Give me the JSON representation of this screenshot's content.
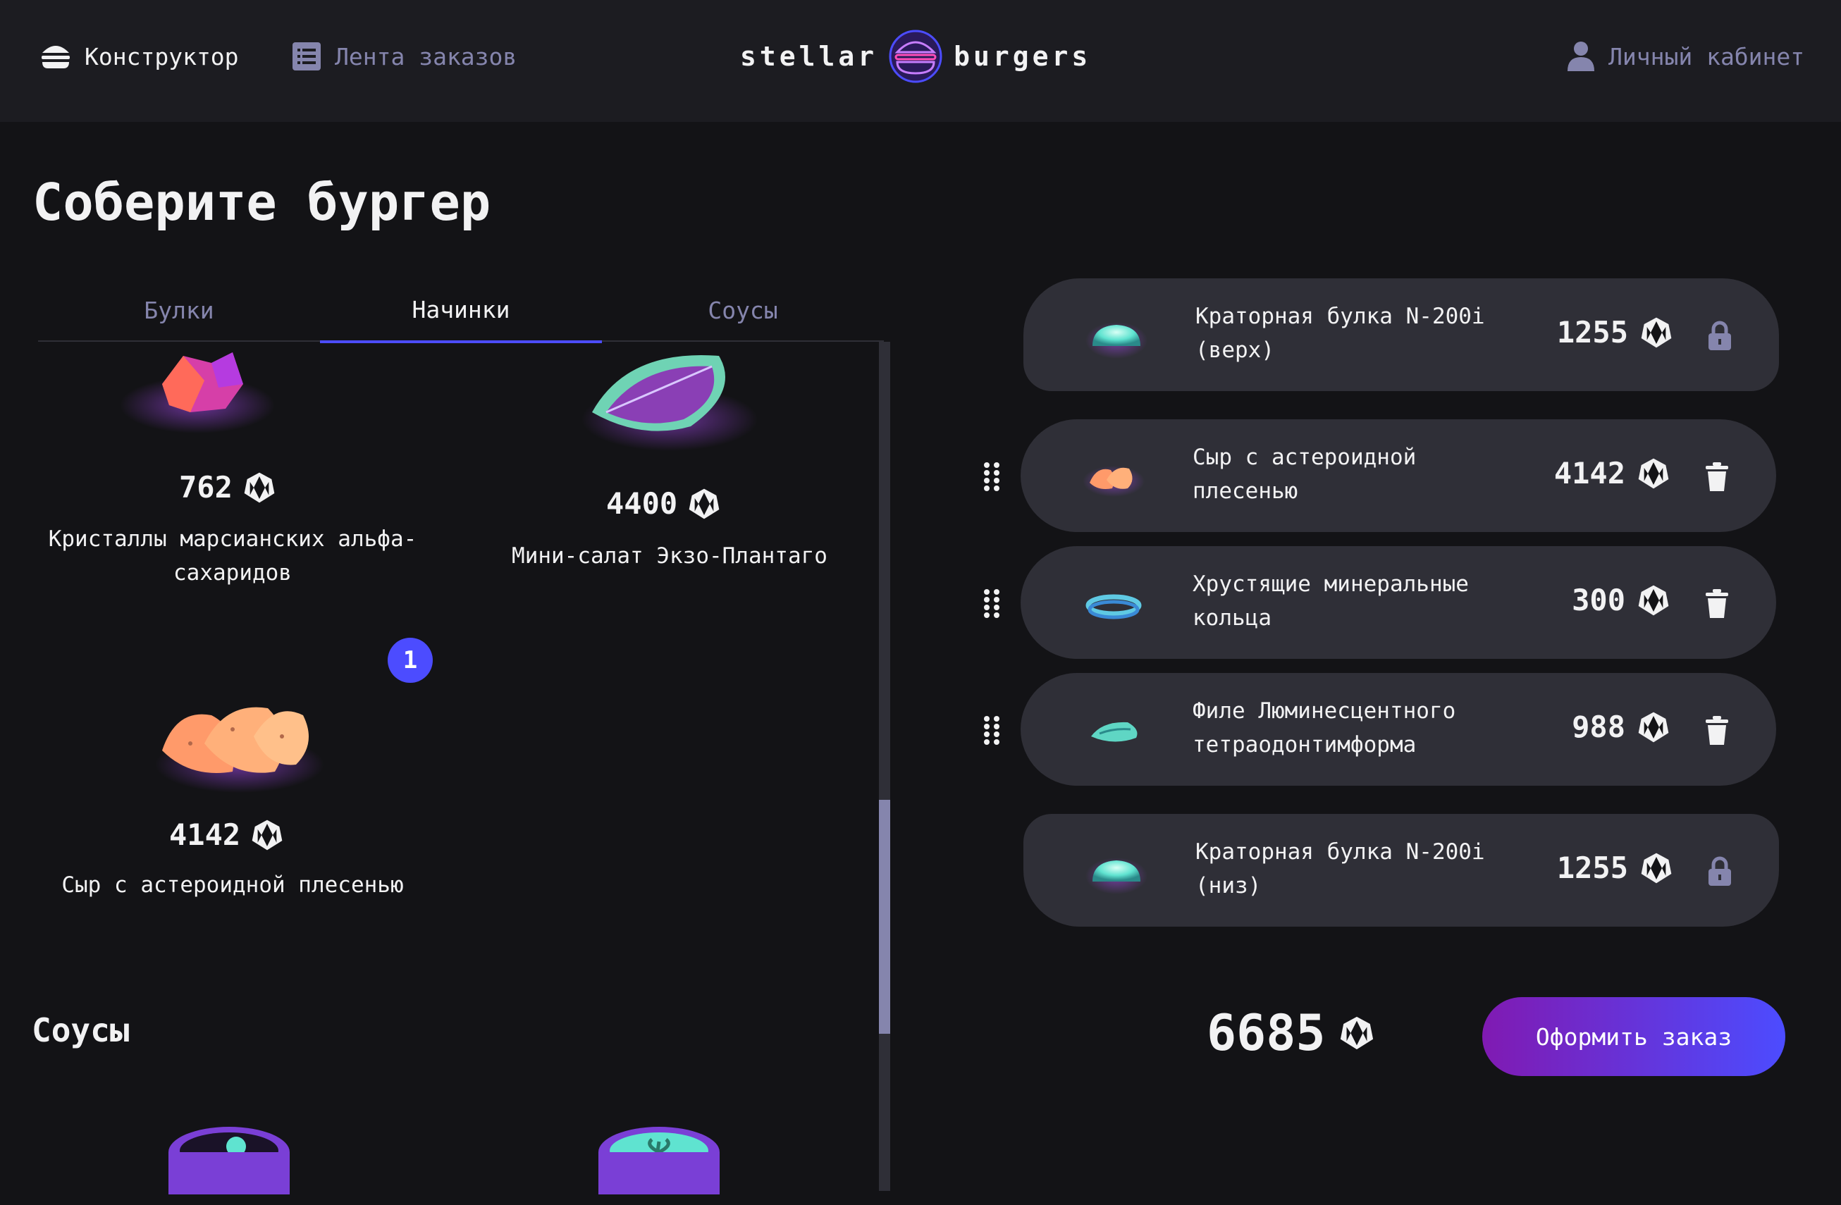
{
  "header": {
    "nav_constructor": "Конструктор",
    "nav_feed": "Лента заказов",
    "logo_left": "stellar",
    "logo_right": "burgers",
    "nav_profile": "Личный кабинет"
  },
  "page_title": "Соберите бургер",
  "tabs": [
    {
      "label": "Булки",
      "active": false
    },
    {
      "label": "Начинки",
      "active": true
    },
    {
      "label": "Соусы",
      "active": false
    }
  ],
  "ingredients": [
    {
      "name": "Кристаллы марсианских альфа-сахаридов",
      "price": "762",
      "icon": "crystals-icon"
    },
    {
      "name": "Мини-салат Экзо-Плантаго",
      "price": "4400",
      "icon": "salad-leaf-icon"
    },
    {
      "name": "Сыр с астероидной плесенью",
      "price": "4142",
      "icon": "cheese-icon",
      "count": "1"
    }
  ],
  "sauces_section_title": "Соусы",
  "constructor": {
    "items": [
      {
        "name": "Краторная булка N-200i (верх)",
        "price": "1255",
        "locked": true
      },
      {
        "name": "Сыр с астероидной плесенью",
        "price": "4142",
        "locked": false
      },
      {
        "name": "Хрустящие минеральные кольца",
        "price": "300",
        "locked": false
      },
      {
        "name": "Филе Люминесцентного тетраодонтимформа",
        "price": "988",
        "locked": false
      },
      {
        "name": "Краторная булка N-200i (низ)",
        "price": "1255",
        "locked": true
      }
    ],
    "total": "6685",
    "order_button": "Оформить заказ"
  },
  "colors": {
    "background": "#131316",
    "header": "#1c1c21",
    "row": "#2f2f37",
    "accent": "#4c4cff",
    "inactive_text": "#8585ad"
  }
}
